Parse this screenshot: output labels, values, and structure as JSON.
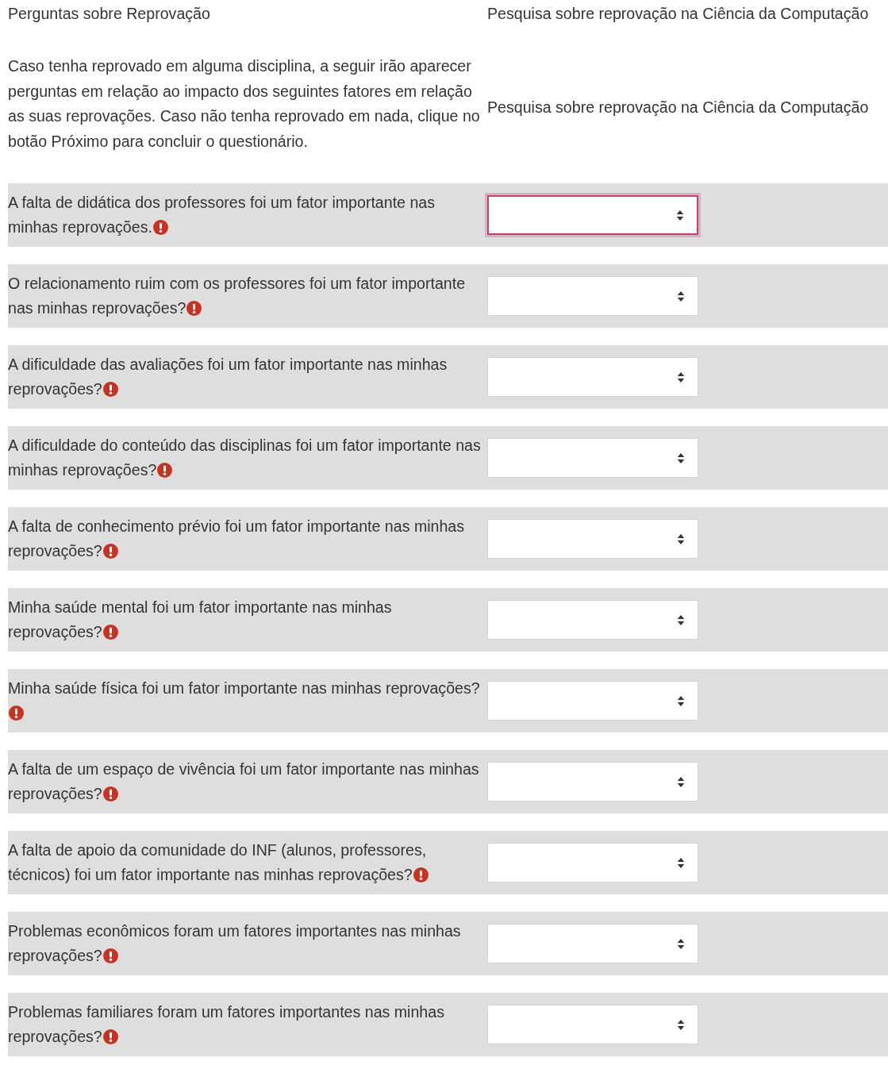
{
  "header": {
    "section_title": "Perguntas sobre Reprovação",
    "survey_title": "Pesquisa sobre reprovação na Ciência da Computação"
  },
  "intro": {
    "text": "Caso tenha reprovado em alguma disciplina, a seguir irão aparecer perguntas em relação ao impacto dos seguintes fatores em relação as suas reprovações. Caso não tenha reprovado em nada, clique no botão Próximo para concluir o questionário.",
    "survey_title": "Pesquisa sobre reprovação na Ciência da Computação"
  },
  "questions": [
    {
      "text": "A falta de didática dos professores foi um fator importante nas minhas reprovações.",
      "required": true,
      "focused": true
    },
    {
      "text": "O relacionamento ruim com os professores foi um fator importante nas minhas reprovações?",
      "required": true,
      "focused": false
    },
    {
      "text": "A dificuldade das avaliações foi um fator importante nas minhas reprovações?",
      "required": true,
      "focused": false
    },
    {
      "text": "A dificuldade do conteúdo das disciplinas foi um fator importante nas minhas reprovações?",
      "required": true,
      "focused": false
    },
    {
      "text": "A falta de conhecimento prévio foi um fator importante nas minhas reprovações?",
      "required": true,
      "focused": false
    },
    {
      "text": "Minha saúde mental foi um fator importante nas minhas reprovações?",
      "required": true,
      "focused": false
    },
    {
      "text": "Minha saúde física foi um fator importante nas minhas reprovações?",
      "required": true,
      "focused": false
    },
    {
      "text": "A falta de um espaço de vivência foi um fator importante nas minhas reprovações?",
      "required": true,
      "focused": false
    },
    {
      "text": "A falta de apoio da comunidade do INF (alunos, professores, técnicos) foi um fator importante nas minhas reprovações?",
      "required": true,
      "focused": false
    },
    {
      "text": "Problemas econômicos foram um fatores importantes nas minhas reprovações?",
      "required": true,
      "focused": false
    },
    {
      "text": "Problemas familiares foram um fatores importantes nas minhas reprovações?",
      "required": true,
      "focused": false
    }
  ]
}
